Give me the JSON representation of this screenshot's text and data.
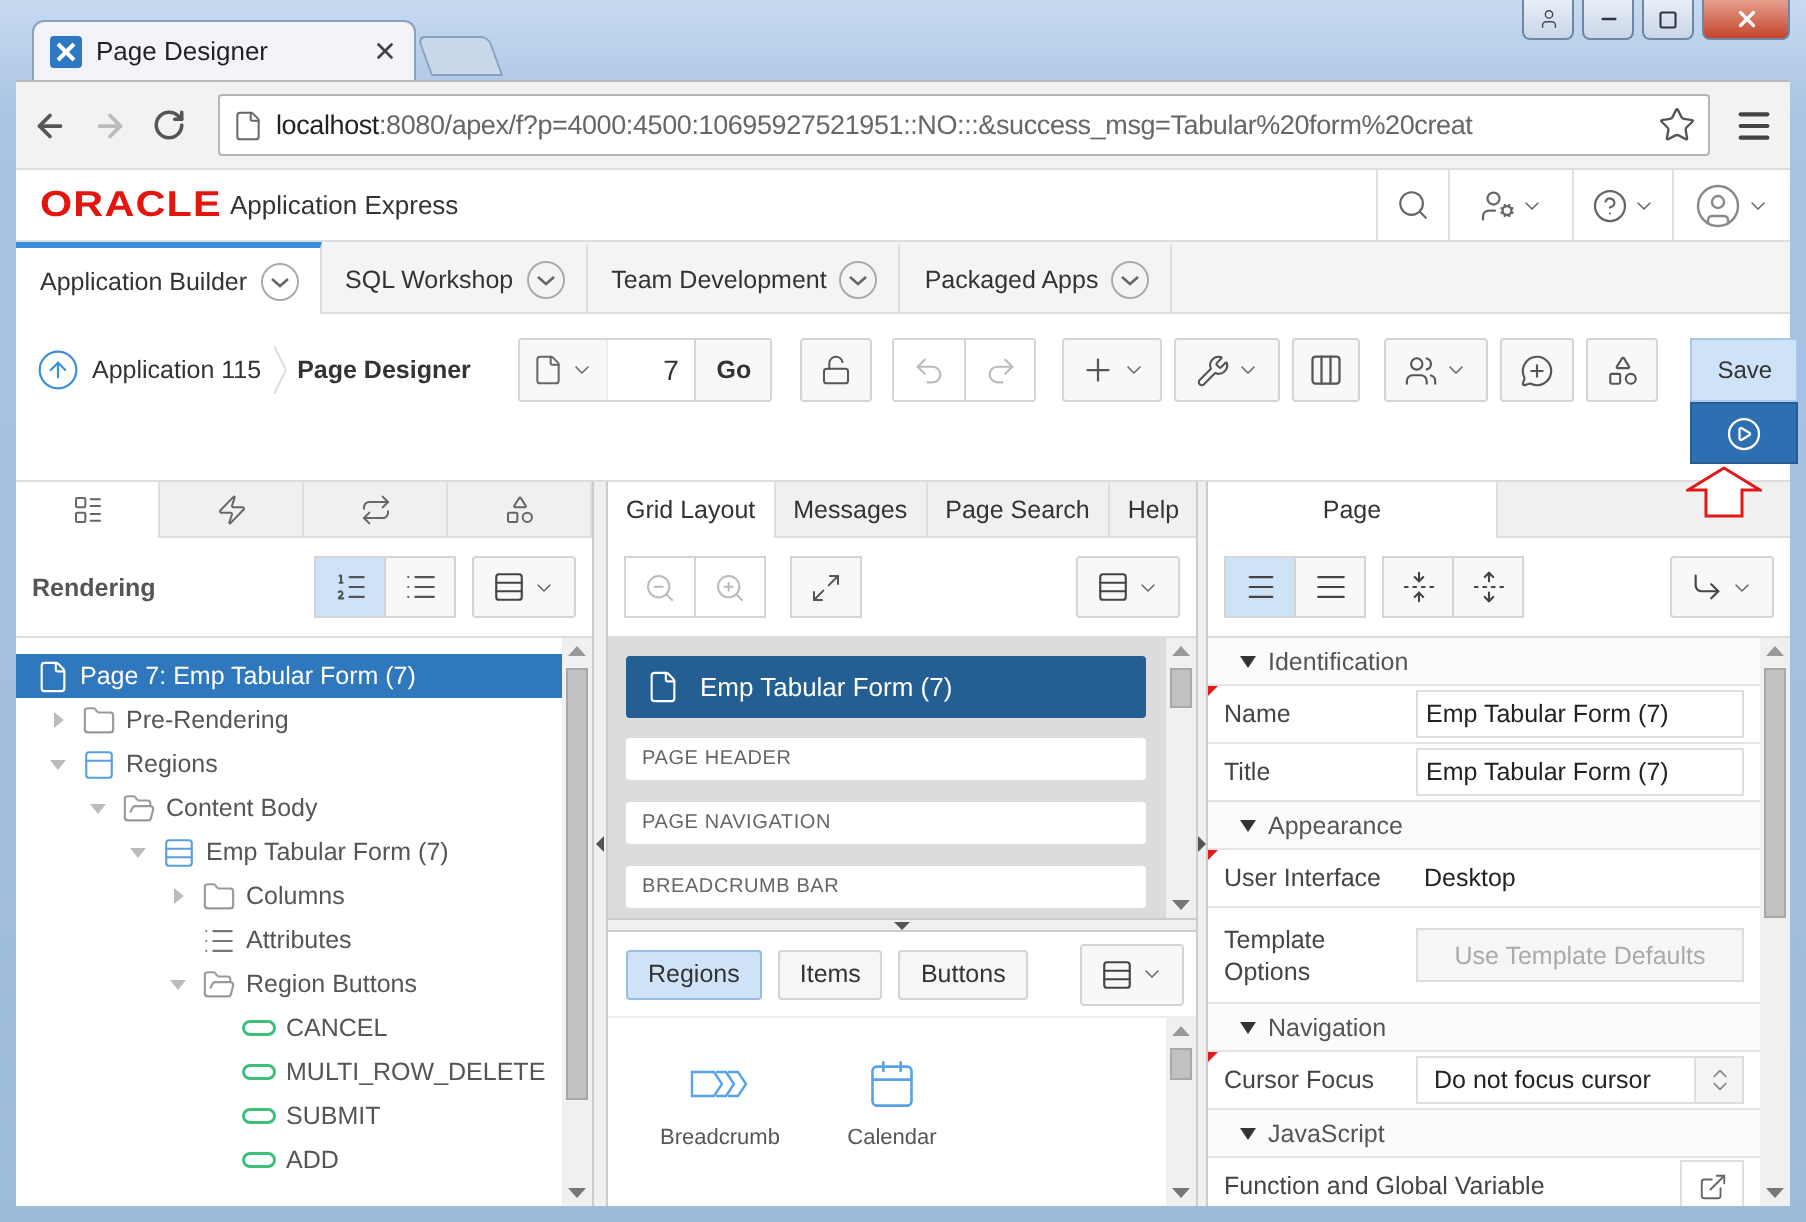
{
  "browser": {
    "tab_title": "Page Designer",
    "url_host": "localhost",
    "url_path": ":8080/apex/f?p=4000:4500:10695927521951::NO:::&success_msg=Tabular%20form%20creat"
  },
  "header": {
    "brand": "ORACLE",
    "product": "Application Express"
  },
  "nav_tabs": [
    {
      "label": "Application Builder",
      "selected": true
    },
    {
      "label": "SQL Workshop",
      "selected": false
    },
    {
      "label": "Team Development",
      "selected": false
    },
    {
      "label": "Packaged Apps",
      "selected": false
    }
  ],
  "toolbar": {
    "breadcrumb": [
      {
        "label": "Application 115",
        "current": false
      },
      {
        "label": "Page Designer",
        "current": true
      }
    ],
    "page_number": "7",
    "go_label": "Go",
    "history": [
      {
        "kind": "undo",
        "disabled": true
      },
      {
        "kind": "redo",
        "disabled": true
      }
    ],
    "save_label": "Save"
  },
  "left_panel": {
    "tabs": [
      {
        "kind": "rendering",
        "selected": true
      },
      {
        "kind": "dynamic_actions",
        "selected": false
      },
      {
        "kind": "processing",
        "selected": false
      },
      {
        "kind": "shared",
        "selected": false
      }
    ],
    "title": "Rendering",
    "view_modes": [
      {
        "kind": "ordered",
        "selected": true
      },
      {
        "kind": "component",
        "selected": false
      }
    ],
    "tree": [
      {
        "label": "Page 7: Emp Tabular Form (7)",
        "kind": "page",
        "selected": true,
        "children": [
          {
            "label": "Pre-Rendering",
            "kind": "folder",
            "expanded": false,
            "selected": false
          },
          {
            "label": "Regions",
            "kind": "regions",
            "expanded": true,
            "selected": false,
            "children": [
              {
                "label": "Content Body",
                "kind": "folder",
                "expanded": true,
                "selected": false,
                "children": [
                  {
                    "label": "Emp Tabular Form (7)",
                    "kind": "region",
                    "expanded": true,
                    "selected": false,
                    "children": [
                      {
                        "label": "Columns",
                        "kind": "folder",
                        "expanded": false,
                        "selected": false
                      },
                      {
                        "label": "Attributes",
                        "kind": "attributes",
                        "selected": false
                      },
                      {
                        "label": "Region Buttons",
                        "kind": "folder",
                        "expanded": true,
                        "selected": false,
                        "children": [
                          {
                            "label": "CANCEL",
                            "kind": "button",
                            "selected": false
                          },
                          {
                            "label": "MULTI_ROW_DELETE",
                            "kind": "button",
                            "selected": false
                          },
                          {
                            "label": "SUBMIT",
                            "kind": "button",
                            "selected": false
                          },
                          {
                            "label": "ADD",
                            "kind": "button",
                            "selected": false
                          }
                        ]
                      }
                    ]
                  }
                ]
              }
            ]
          }
        ]
      }
    ]
  },
  "middle_panel": {
    "tabs": [
      {
        "label": "Grid Layout",
        "selected": true
      },
      {
        "label": "Messages",
        "selected": false
      },
      {
        "label": "Page Search",
        "selected": false
      },
      {
        "label": "Help",
        "selected": false
      }
    ],
    "zoom_controls": [
      {
        "kind": "zoom_out",
        "disabled": true
      },
      {
        "kind": "zoom_in",
        "disabled": true
      }
    ],
    "grid": [
      {
        "label": "Emp Tabular Form (7)",
        "kind": "page"
      },
      {
        "label": "PAGE HEADER",
        "kind": "position"
      },
      {
        "label": "PAGE NAVIGATION",
        "kind": "position"
      },
      {
        "label": "BREADCRUMB BAR",
        "kind": "position"
      }
    ],
    "gallery_tabs": [
      {
        "label": "Regions",
        "selected": true
      },
      {
        "label": "Items",
        "selected": false
      },
      {
        "label": "Buttons",
        "selected": false
      }
    ],
    "gallery": [
      {
        "label": "Breadcrumb",
        "kind": "breadcrumb"
      },
      {
        "label": "Calendar",
        "kind": "calendar"
      }
    ]
  },
  "right_panel": {
    "tabs": [
      {
        "label": "Page",
        "selected": true
      }
    ],
    "view_modes": [
      {
        "kind": "common",
        "selected": true
      },
      {
        "kind": "all",
        "selected": false
      }
    ],
    "groups": [
      {
        "title": "Identification",
        "expanded": true,
        "properties": [
          {
            "label": "Name",
            "kind": "text",
            "value": "Emp Tabular Form (7)",
            "required": true
          },
          {
            "label": "Title",
            "kind": "text",
            "value": "Emp Tabular Form (7)",
            "required": false
          }
        ]
      },
      {
        "title": "Appearance",
        "expanded": true,
        "properties": [
          {
            "label": "User Interface",
            "kind": "static",
            "value": "Desktop",
            "required": true
          },
          {
            "label": "Template Options",
            "kind": "button",
            "value": "Use Template Defaults",
            "required": false
          }
        ]
      },
      {
        "title": "Navigation",
        "expanded": true,
        "properties": [
          {
            "label": "Cursor Focus",
            "kind": "select",
            "value": "Do not focus cursor",
            "required": true
          }
        ]
      },
      {
        "title": "JavaScript",
        "expanded": true,
        "properties": [
          {
            "label": "Function and Global Variable",
            "kind": "code",
            "required": false
          }
        ]
      }
    ]
  }
}
